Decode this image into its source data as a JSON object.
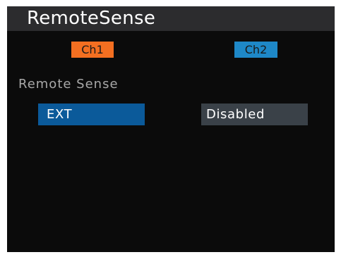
{
  "title": "RemoteSense",
  "channels": {
    "ch1": {
      "label": "Ch1",
      "color": "#f36f21",
      "value": "EXT",
      "value_bg": "#0b5a9a"
    },
    "ch2": {
      "label": "Ch2",
      "color": "#1e88c7",
      "value": "Disabled",
      "value_bg": "#3a4148"
    }
  },
  "setting": {
    "label": "Remote Sense"
  }
}
